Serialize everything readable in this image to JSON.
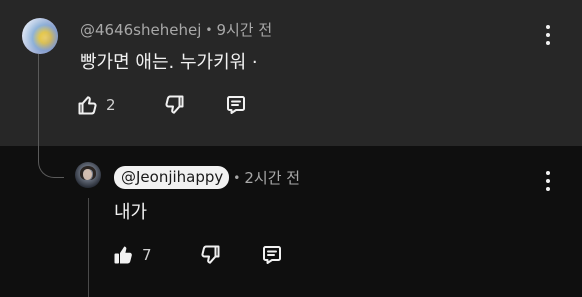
{
  "comment": {
    "handle": "@4646shehehej",
    "separator": "•",
    "time": "9시간 전",
    "text": "빵가면 애는. 누가키워 ·",
    "likes": "2",
    "icons": {
      "like": "thumbs-up-icon",
      "dislike": "thumbs-down-icon",
      "reply": "reply-comment-icon",
      "menu": "more-vert-icon"
    }
  },
  "reply": {
    "handle": "@Jeonjihappy",
    "separator": "•",
    "time": "2시간 전",
    "text": "내가",
    "likes": "7",
    "icons": {
      "like": "thumbs-up-filled-icon",
      "dislike": "thumbs-down-icon",
      "reply": "reply-comment-icon",
      "menu": "more-vert-icon"
    }
  },
  "colors": {
    "top_background": "#272727",
    "reply_background": "#0f0f0f",
    "text_primary": "#f1f1f1",
    "text_secondary": "#a8a8a8",
    "pill_background": "#f2f2f2"
  }
}
